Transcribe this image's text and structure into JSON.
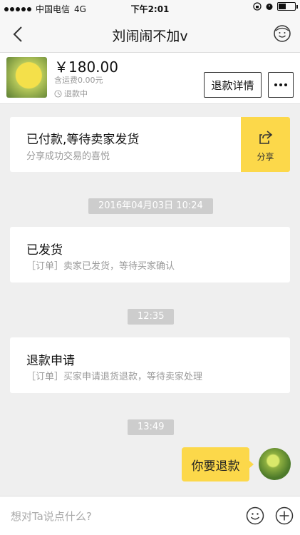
{
  "status_bar": {
    "carrier": "中国电信",
    "network": "4G",
    "time": "下午2:01"
  },
  "nav": {
    "title": "刘闹闹不加v",
    "icons": {
      "back": "chevron-left-icon",
      "user": "user-face-icon"
    }
  },
  "order": {
    "price": "￥180.00",
    "shipping": "含运费0.00元",
    "status": "退款中",
    "detail_button": "退款详情",
    "more_icon": "more-dots-icon"
  },
  "messages": {
    "payment_card": {
      "title": "已付款,等待卖家发货",
      "subtitle": "分享成功交易的喜悦",
      "share_label": "分享"
    },
    "timestamps": [
      "2016年04月03日 10:24",
      "12:35",
      "13:49"
    ],
    "shipped_card": {
      "title": "已发货",
      "subtitle": "［订单］卖家已发货，等待买家确认"
    },
    "refund_card": {
      "title": "退款申请",
      "subtitle": "［订单］买家申请退货退款，等待卖家处理"
    },
    "my_message": "你要退款"
  },
  "input": {
    "placeholder": "想对Ta说点什么?"
  },
  "colors": {
    "accent_yellow": "#fcd84a",
    "background": "#efefef",
    "pill_gray": "#cdcdcd"
  }
}
